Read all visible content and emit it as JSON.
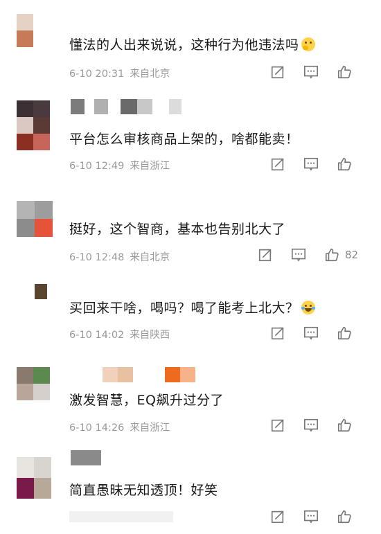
{
  "icons": [
    "share-icon",
    "reply-icon",
    "like-icon"
  ],
  "comments": [
    {
      "text": "懂法的人出来说说，这种行为他违法吗",
      "emoji": "thinking-face",
      "time": "6-10 20:31",
      "location": "来自北京",
      "likes": "",
      "avatar_colors": [
        "#d8c2b6",
        "#ffffff",
        "#c77a58",
        "#ffffff"
      ],
      "name_colors": []
    },
    {
      "text": "平台怎么审核商品上架的，啥都能卖！",
      "emoji": "",
      "time": "6-10 12:49",
      "location": "来自浙江",
      "likes": "",
      "avatar_colors": [
        "#3d3035",
        "#4a3a3e",
        "#d9c9c6",
        "#5b3a36",
        "#8b2f23",
        "#c7655a"
      ],
      "name_colors": [
        "#7c7c7c",
        "#b0b0b0",
        "#6a6a6a",
        "#c8c8c8",
        "#dcdcdc"
      ]
    },
    {
      "text": "挺好，这个智商，基本也告别北大了",
      "emoji": "",
      "time": "6-10 12:48",
      "location": "来自北京",
      "likes": "82",
      "avatar_colors": [
        "#b4b4b4",
        "#9d9d9d",
        "#8c8c8c",
        "#e4533a"
      ],
      "name_colors": []
    },
    {
      "text": "买回来干啥，喝吗？喝了能考上北大？",
      "emoji": "laughing-crying-face",
      "time": "6-10 14:02",
      "location": "来自陕西",
      "likes": "",
      "avatar_colors": [
        "#ffffff",
        "#5a4630",
        "#ffffff",
        "#ffffff"
      ],
      "name_colors": []
    },
    {
      "text": "激发智慧，EQ飙升过分了",
      "emoji": "",
      "time": "6-10 14:26",
      "location": "来自浙江",
      "likes": "",
      "avatar_colors": [
        "#8a7a6e",
        "#5c8a4e",
        "#b9a59a",
        "#d6d0cc"
      ],
      "name_colors": [
        "#f0d2bc",
        "#e8c2a0",
        "#ee6a1e",
        "#f6b38a"
      ]
    },
    {
      "text": "简直愚昧无知透顶！好笑",
      "emoji": "",
      "time": "",
      "location": "",
      "likes": "",
      "avatar_colors": [
        "#e8e4e0",
        "#d8d4d0",
        "#7a1a4a",
        "#b8a898"
      ],
      "name_colors": [
        "#8a8a8a"
      ]
    }
  ]
}
